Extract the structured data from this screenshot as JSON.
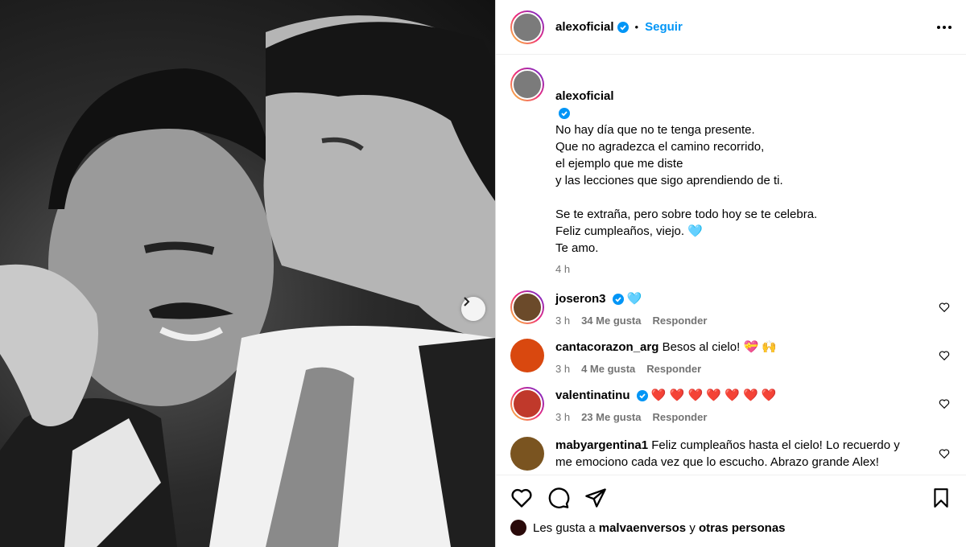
{
  "post": {
    "author": "alexoficial",
    "follow_label": "Seguir",
    "caption_lines": "No hay día que no te tenga presente.\nQue no agradezca el camino recorrido,\nel ejemplo que me diste\ny las lecciones que sigo aprendiendo de ti.\n\nSe te extraña, pero sobre todo hoy se te celebra.\nFeliz cumpleaños, viejo. 🩵\nTe amo.",
    "caption_time": "4 h"
  },
  "comments": [
    {
      "user": "joseron3",
      "verified": true,
      "text": "🩵",
      "time": "3 h",
      "likes": "34 Me gusta",
      "reply": "Responder"
    },
    {
      "user": "cantacorazon_arg",
      "verified": false,
      "text": "Besos al cielo! 💝 🙌",
      "time": "3 h",
      "likes": "4 Me gusta",
      "reply": "Responder"
    },
    {
      "user": "valentinatinu",
      "verified": true,
      "text": "❤️ ❤️ ❤️ ❤️ ❤️ ❤️ ❤️",
      "time": "3 h",
      "likes": "23 Me gusta",
      "reply": "Responder"
    },
    {
      "user": "mabyargentina1",
      "verified": false,
      "text": "Feliz cumpleaños hasta el cielo! Lo recuerdo y me emociono cada vez que lo escucho. Abrazo grande Alex!"
    }
  ],
  "likes_line": {
    "prefix": "Les gusta a",
    "user": "malvaenversos",
    "joiner": "y",
    "others": "otras personas"
  },
  "icons": [
    "verified-icon",
    "more-icon",
    "heart-icon",
    "comment-icon",
    "share-icon",
    "save-icon",
    "chevron-right-icon"
  ],
  "colors": {
    "accent": "#0095f6",
    "muted": "#737373",
    "border": "#dbdbdb"
  }
}
